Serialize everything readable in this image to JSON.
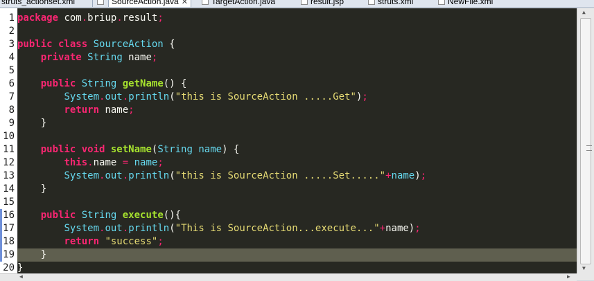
{
  "tabs": [
    {
      "label": "struts_actionset.xml",
      "active": false
    },
    {
      "label": "SourceAction.java",
      "active": true
    },
    {
      "label": "TargetAction.java",
      "active": false
    },
    {
      "label": "result.jsp",
      "active": false
    },
    {
      "label": "struts.xml",
      "active": false
    },
    {
      "label": "NewFile.xml",
      "active": false
    }
  ],
  "colors": {
    "editor_bg": "#272822",
    "keyword": "#f92672",
    "type": "#66d9ef",
    "function": "#a6e22e",
    "string": "#e6db74",
    "text": "#f8f8f2",
    "current_line": "#5f5f4f"
  },
  "editor": {
    "current_line": 19,
    "lines": [
      [
        [
          "kw",
          "package"
        ],
        [
          "pkg",
          " com"
        ],
        [
          "punc",
          "."
        ],
        [
          "pkg",
          "briup"
        ],
        [
          "punc",
          "."
        ],
        [
          "pkg",
          "result"
        ],
        [
          "punc",
          ";"
        ]
      ],
      [],
      [
        [
          "kw",
          "public class"
        ],
        [
          "text",
          " "
        ],
        [
          "type",
          "SourceAction"
        ],
        [
          "text",
          " {"
        ]
      ],
      [
        [
          "text",
          "    "
        ],
        [
          "kw",
          "private"
        ],
        [
          "text",
          " "
        ],
        [
          "type",
          "String"
        ],
        [
          "text",
          " name"
        ],
        [
          "punc",
          ";"
        ]
      ],
      [],
      [
        [
          "text",
          "    "
        ],
        [
          "kw",
          "public"
        ],
        [
          "text",
          " "
        ],
        [
          "type",
          "String"
        ],
        [
          "text",
          " "
        ],
        [
          "fn",
          "getName"
        ],
        [
          "text",
          "() {"
        ]
      ],
      [
        [
          "text",
          "        "
        ],
        [
          "type",
          "System"
        ],
        [
          "punc",
          "."
        ],
        [
          "field",
          "out"
        ],
        [
          "punc",
          "."
        ],
        [
          "field",
          "println"
        ],
        [
          "text",
          "("
        ],
        [
          "str",
          "\"this is SourceAction .....Get\""
        ],
        [
          "text",
          ")"
        ],
        [
          "punc",
          ";"
        ]
      ],
      [
        [
          "text",
          "        "
        ],
        [
          "kw",
          "return"
        ],
        [
          "text",
          " name"
        ],
        [
          "punc",
          ";"
        ]
      ],
      [
        [
          "text",
          "    }"
        ]
      ],
      [],
      [
        [
          "text",
          "    "
        ],
        [
          "kw",
          "public void"
        ],
        [
          "text",
          " "
        ],
        [
          "fn",
          "setName"
        ],
        [
          "text",
          "("
        ],
        [
          "type",
          "String"
        ],
        [
          "text",
          " "
        ],
        [
          "field",
          "name"
        ],
        [
          "text",
          ") {"
        ]
      ],
      [
        [
          "text",
          "        "
        ],
        [
          "kw",
          "this"
        ],
        [
          "punc",
          "."
        ],
        [
          "text",
          "name "
        ],
        [
          "punc",
          "="
        ],
        [
          "text",
          " "
        ],
        [
          "field",
          "name"
        ],
        [
          "punc",
          ";"
        ]
      ],
      [
        [
          "text",
          "        "
        ],
        [
          "type",
          "System"
        ],
        [
          "punc",
          "."
        ],
        [
          "field",
          "out"
        ],
        [
          "punc",
          "."
        ],
        [
          "field",
          "println"
        ],
        [
          "text",
          "("
        ],
        [
          "str",
          "\"this is SourceAction .....Set.....\""
        ],
        [
          "punc",
          "+"
        ],
        [
          "field",
          "name"
        ],
        [
          "text",
          ")"
        ],
        [
          "punc",
          ";"
        ]
      ],
      [
        [
          "text",
          "    }"
        ]
      ],
      [],
      [
        [
          "text",
          "    "
        ],
        [
          "kw",
          "public"
        ],
        [
          "text",
          " "
        ],
        [
          "type",
          "String"
        ],
        [
          "text",
          " "
        ],
        [
          "fn",
          "execute"
        ],
        [
          "text",
          "()"
        ],
        [
          "text",
          "{"
        ]
      ],
      [
        [
          "text",
          "        "
        ],
        [
          "type",
          "System"
        ],
        [
          "punc",
          "."
        ],
        [
          "field",
          "out"
        ],
        [
          "punc",
          "."
        ],
        [
          "field",
          "println"
        ],
        [
          "text",
          "("
        ],
        [
          "str",
          "\"This is SourceAction...execute...\""
        ],
        [
          "punc",
          "+"
        ],
        [
          "text",
          "name)"
        ],
        [
          "punc",
          ";"
        ]
      ],
      [
        [
          "text",
          "        "
        ],
        [
          "kw",
          "return"
        ],
        [
          "text",
          " "
        ],
        [
          "str",
          "\"success\""
        ],
        [
          "punc",
          ";"
        ]
      ],
      [
        [
          "text",
          "    }"
        ]
      ],
      [
        [
          "text",
          "}"
        ]
      ]
    ]
  }
}
